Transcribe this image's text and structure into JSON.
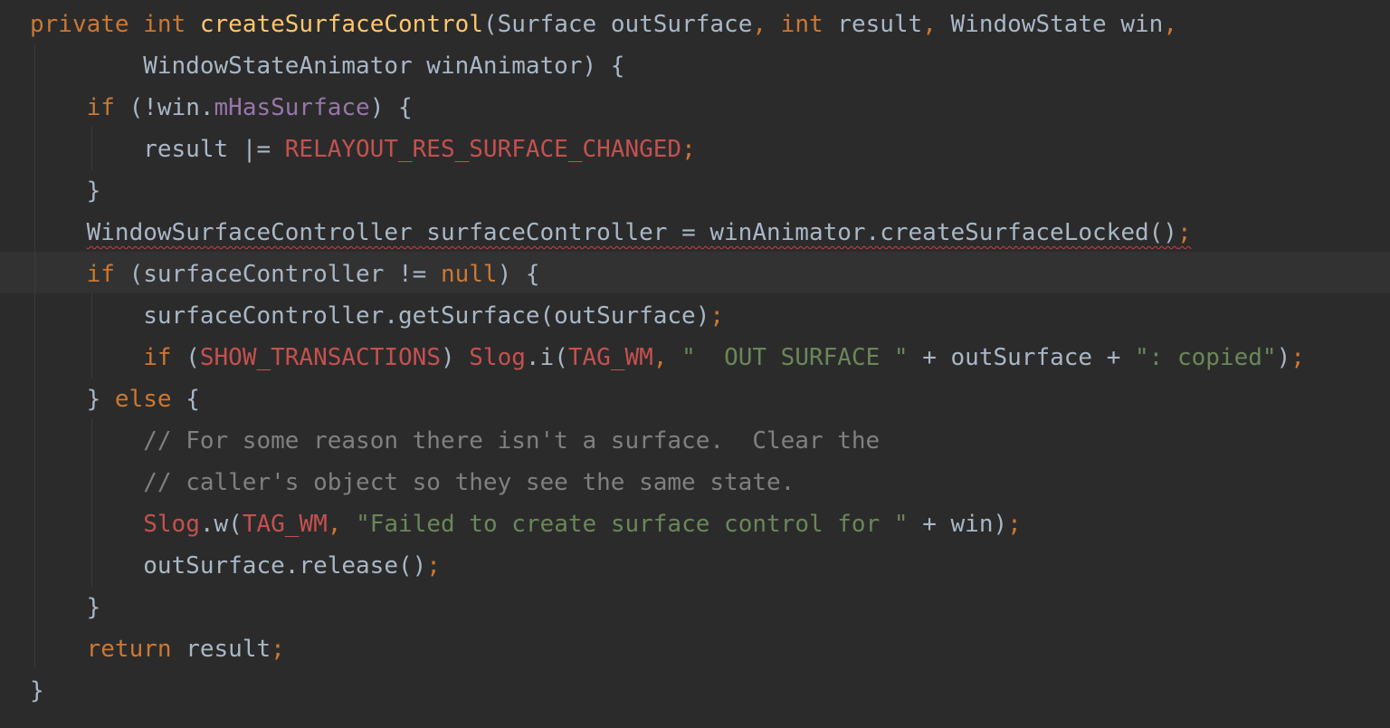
{
  "colors": {
    "background": "#2b2b2b",
    "current_line": "#323232",
    "plain": "#a9b7c6",
    "keyword": "#cc7832",
    "method": "#ffc66d",
    "field": "#9876aa",
    "constant": "#c4514f",
    "string": "#6a8759",
    "comment": "#808080",
    "error_underline": "#d04040"
  },
  "code": {
    "lines": [
      [
        {
          "t": "private",
          "c": "kw"
        },
        {
          "t": " "
        },
        {
          "t": "int",
          "c": "kw"
        },
        {
          "t": " "
        },
        {
          "t": "createSurfaceControl",
          "c": "fn"
        },
        {
          "t": "(Surface outSurface"
        },
        {
          "t": ",",
          "c": "kw"
        },
        {
          "t": " "
        },
        {
          "t": "int",
          "c": "kw"
        },
        {
          "t": " result"
        },
        {
          "t": ",",
          "c": "kw"
        },
        {
          "t": " WindowState win"
        },
        {
          "t": ",",
          "c": "kw"
        }
      ],
      [
        {
          "t": "        WindowStateAnimator winAnimator) {"
        }
      ],
      [
        {
          "t": "    "
        },
        {
          "t": "if",
          "c": "kw"
        },
        {
          "t": " (!win."
        },
        {
          "t": "mHasSurface",
          "c": "field"
        },
        {
          "t": ") {"
        }
      ],
      [
        {
          "t": "        result |= "
        },
        {
          "t": "RELAYOUT_RES_SURFACE_CHANGED",
          "c": "const"
        },
        {
          "t": ";",
          "c": "kw"
        }
      ],
      [
        {
          "t": "    }"
        }
      ],
      [
        {
          "t": "    "
        },
        {
          "t": "WindowSurfaceController surfaceController = winAnimator.createSurfaceLocked()",
          "e": true
        },
        {
          "t": ";",
          "c": "kw",
          "e": true
        }
      ],
      [
        {
          "t": "    "
        },
        {
          "t": "if",
          "c": "kw"
        },
        {
          "t": " (surfaceController != "
        },
        {
          "t": "null",
          "c": "kw"
        },
        {
          "t": ") {"
        }
      ],
      [
        {
          "t": "        surfaceController.getSurface(outSurface)"
        },
        {
          "t": ";",
          "c": "kw"
        }
      ],
      [
        {
          "t": "        "
        },
        {
          "t": "if",
          "c": "kw"
        },
        {
          "t": " ("
        },
        {
          "t": "SHOW_TRANSACTIONS",
          "c": "const"
        },
        {
          "t": ") "
        },
        {
          "t": "Slog",
          "c": "const"
        },
        {
          "t": ".i("
        },
        {
          "t": "TAG_WM",
          "c": "const"
        },
        {
          "t": ",",
          "c": "kw"
        },
        {
          "t": " "
        },
        {
          "t": "\"  OUT SURFACE \"",
          "c": "str"
        },
        {
          "t": " + outSurface + "
        },
        {
          "t": "\": copied\"",
          "c": "str"
        },
        {
          "t": ")"
        },
        {
          "t": ";",
          "c": "kw"
        }
      ],
      [
        {
          "t": "    } "
        },
        {
          "t": "else",
          "c": "kw"
        },
        {
          "t": " {"
        }
      ],
      [
        {
          "t": "        "
        },
        {
          "t": "// For some reason there isn't a surface.  Clear the",
          "c": "cmt"
        }
      ],
      [
        {
          "t": "        "
        },
        {
          "t": "// caller's object so they see the same state.",
          "c": "cmt"
        }
      ],
      [
        {
          "t": "        "
        },
        {
          "t": "Slog",
          "c": "const"
        },
        {
          "t": ".w("
        },
        {
          "t": "TAG_WM",
          "c": "const"
        },
        {
          "t": ",",
          "c": "kw"
        },
        {
          "t": " "
        },
        {
          "t": "\"Failed to create surface control for \"",
          "c": "str"
        },
        {
          "t": " + win)"
        },
        {
          "t": ";",
          "c": "kw"
        }
      ],
      [
        {
          "t": "        outSurface.release()"
        },
        {
          "t": ";",
          "c": "kw"
        }
      ],
      [
        {
          "t": "    }"
        }
      ],
      [
        {
          "t": "    "
        },
        {
          "t": "return",
          "c": "kw"
        },
        {
          "t": " result"
        },
        {
          "t": ";",
          "c": "kw"
        }
      ],
      [
        {
          "t": "}"
        }
      ]
    ]
  }
}
